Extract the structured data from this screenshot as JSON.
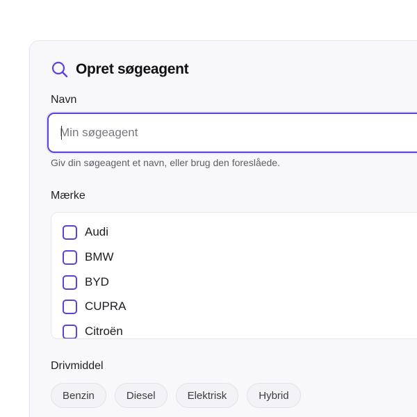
{
  "header": {
    "title": "Opret søgeagent",
    "icon": "search-icon",
    "accent_color": "#5b3fe0"
  },
  "name_field": {
    "label": "Navn",
    "value": "",
    "placeholder": "Min søgeagent",
    "helper": "Giv din søgeagent et navn, eller brug den foreslåede."
  },
  "brand": {
    "label": "Mærke",
    "items": [
      {
        "label": "Audi",
        "checked": false
      },
      {
        "label": "BMW",
        "checked": false
      },
      {
        "label": "BYD",
        "checked": false
      },
      {
        "label": "CUPRA",
        "checked": false
      },
      {
        "label": "Citroën",
        "checked": false
      }
    ]
  },
  "drivetrain": {
    "label": "Drivmiddel",
    "options": [
      {
        "label": "Benzin"
      },
      {
        "label": "Diesel"
      },
      {
        "label": "Elektrisk"
      },
      {
        "label": "Hybrid"
      }
    ]
  }
}
